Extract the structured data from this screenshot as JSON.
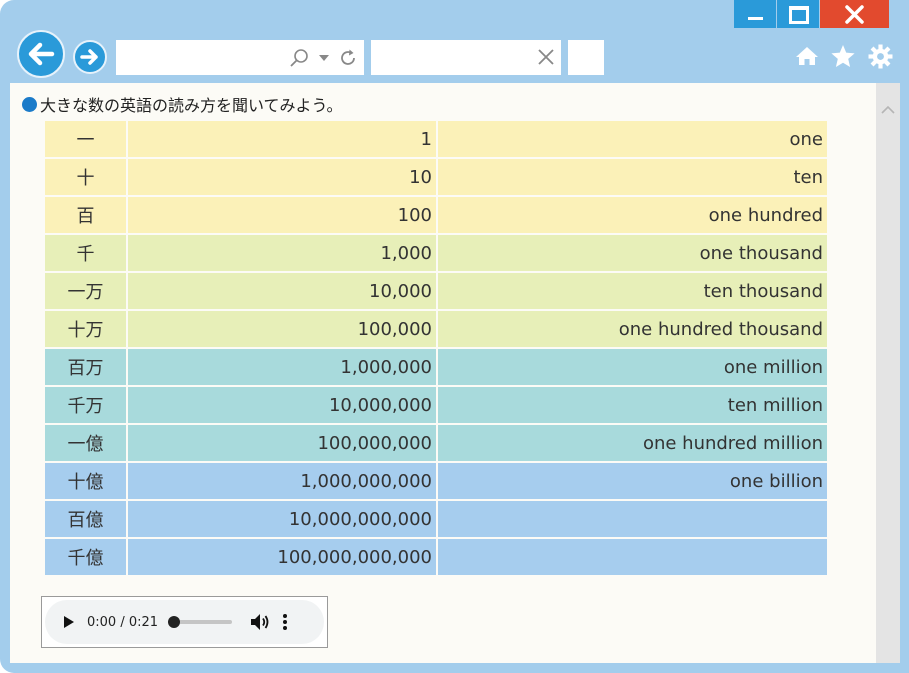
{
  "window": {
    "frame_color": "#a3cdec",
    "accent": "#2a9ad9",
    "close_color": "#e24a2e"
  },
  "toolbar": {
    "icons": [
      "home-icon",
      "star-icon",
      "gear-icon"
    ]
  },
  "content": {
    "heading": "大きな数の英語の読み方を聞いてみよう。",
    "rows": [
      {
        "kanji": "一",
        "number": "1",
        "english": "one",
        "color": "#fbf1b8"
      },
      {
        "kanji": "十",
        "number": "10",
        "english": "ten",
        "color": "#fbf1b8"
      },
      {
        "kanji": "百",
        "number": "100",
        "english": "one hundred",
        "color": "#fbf1b8"
      },
      {
        "kanji": "千",
        "number": "1,000",
        "english": "one thousand",
        "color": "#e7efb8"
      },
      {
        "kanji": "一万",
        "number": "10,000",
        "english": "ten thousand",
        "color": "#e7efb8"
      },
      {
        "kanji": "十万",
        "number": "100,000",
        "english": "one hundred thousand",
        "color": "#e7efb8"
      },
      {
        "kanji": "百万",
        "number": "1,000,000",
        "english": "one million",
        "color": "#a8dadc"
      },
      {
        "kanji": "千万",
        "number": "10,000,000",
        "english": "ten million",
        "color": "#a8dadc"
      },
      {
        "kanji": "一億",
        "number": "100,000,000",
        "english": "one hundred million",
        "color": "#a8dadc"
      },
      {
        "kanji": "十億",
        "number": "1,000,000,000",
        "english": "one billion",
        "color": "#a6cdee"
      },
      {
        "kanji": "百億",
        "number": "10,000,000,000",
        "english": "",
        "color": "#a6cdee"
      },
      {
        "kanji": "千億",
        "number": "100,000,000,000",
        "english": "",
        "color": "#a6cdee"
      }
    ]
  },
  "audio": {
    "time": "0:00 / 0:21",
    "progress": 0
  }
}
